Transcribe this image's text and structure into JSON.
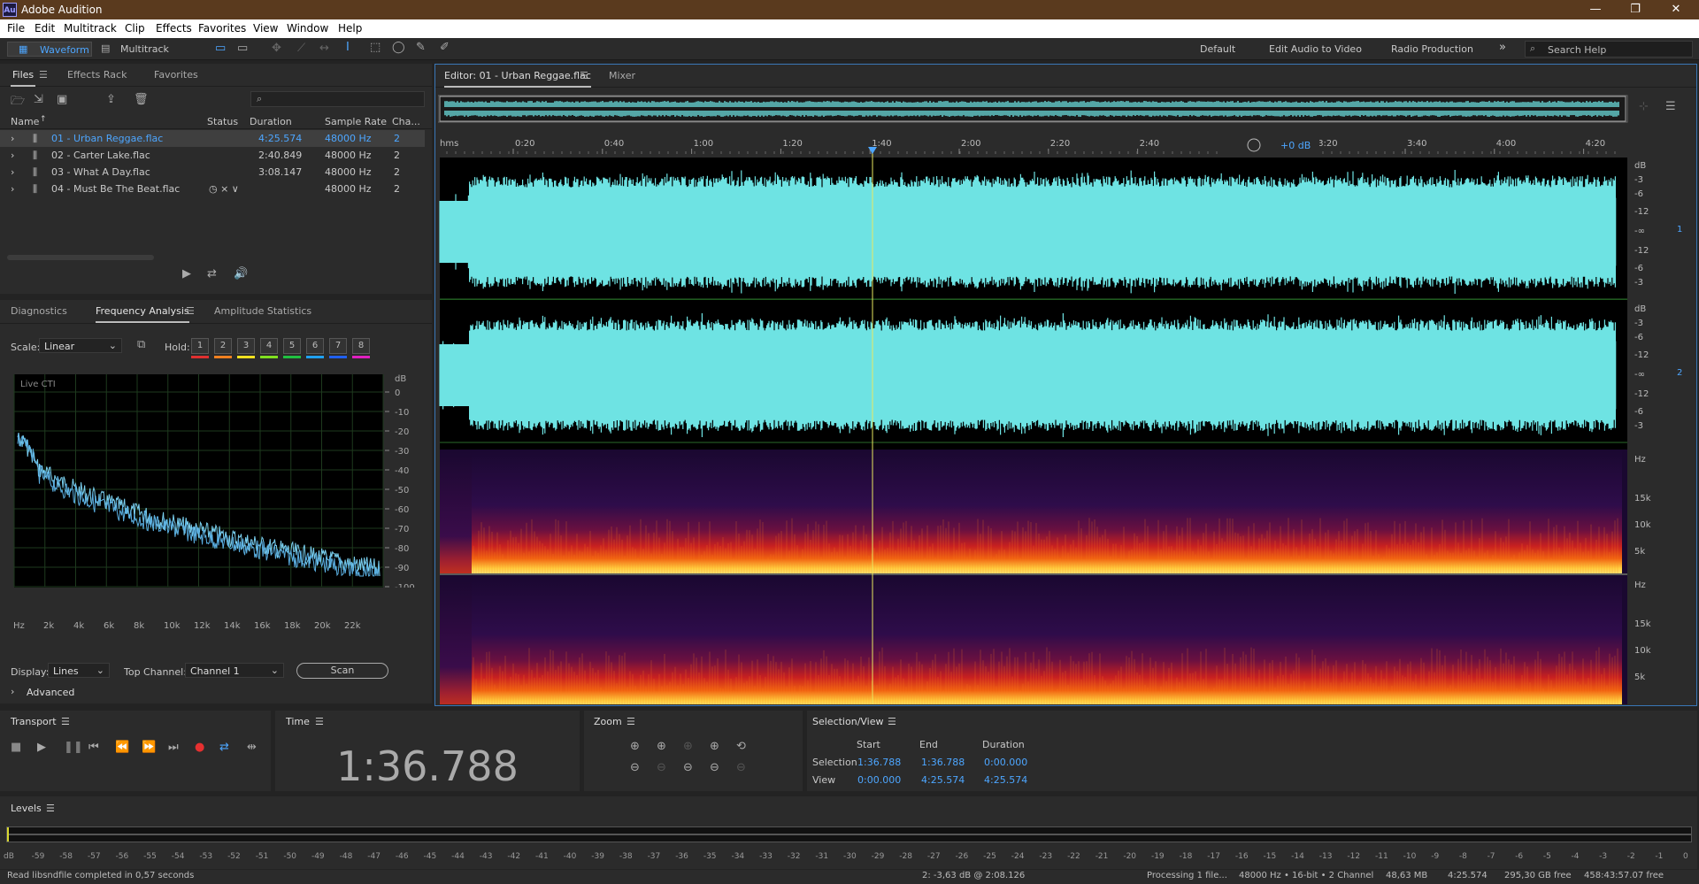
{
  "app": {
    "title": "Adobe Audition",
    "logo": "Au"
  },
  "window_buttons": [
    "—",
    "❐",
    "✕"
  ],
  "menu": [
    "File",
    "Edit",
    "Multitrack",
    "Clip",
    "Effects",
    "Favorites",
    "View",
    "Window",
    "Help"
  ],
  "toolbar": {
    "waveform": "Waveform",
    "multitrack": "Multitrack",
    "workspaces": [
      "Default",
      "Edit Audio to Video",
      "Radio Production"
    ],
    "more": "»",
    "search_placeholder": "Search Help"
  },
  "files_panel": {
    "tabs": [
      "Files",
      "Effects Rack",
      "Favorites"
    ],
    "columns": [
      "Name",
      "Status",
      "Duration",
      "Sample Rate",
      "Cha..."
    ],
    "rows": [
      {
        "name": "01 - Urban Reggae.flac",
        "duration": "4:25.574",
        "rate": "48000 Hz",
        "ch": "2"
      },
      {
        "name": "02 - Carter Lake.flac",
        "duration": "2:40.849",
        "rate": "48000 Hz",
        "ch": "2"
      },
      {
        "name": "03 - What A Day.flac",
        "duration": "3:08.147",
        "rate": "48000 Hz",
        "ch": "2"
      },
      {
        "name": "04 - Must Be The Beat.flac",
        "duration": "",
        "rate": "48000 Hz",
        "ch": "2"
      }
    ]
  },
  "freq_panel": {
    "tabs": [
      "Diagnostics",
      "Frequency Analysis",
      "Amplitude Statistics"
    ],
    "scale_label": "Scale:",
    "scale_value": "Linear",
    "hold_label": "Hold:",
    "holds": [
      "1",
      "2",
      "3",
      "4",
      "5",
      "6",
      "7",
      "8"
    ],
    "hold_colors": [
      "#e03030",
      "#f08020",
      "#f0e020",
      "#80e020",
      "#20c040",
      "#20a0f0",
      "#2060f0",
      "#e020c0"
    ],
    "graph_label": "Live CTI",
    "db_unit": "dB",
    "db_ticks": [
      "0",
      "-10",
      "-20",
      "-30",
      "-40",
      "-50",
      "-60",
      "-70",
      "-80",
      "-90",
      "-100"
    ],
    "hz_ticks": [
      "Hz",
      "2k",
      "4k",
      "6k",
      "8k",
      "10k",
      "12k",
      "14k",
      "16k",
      "18k",
      "20k",
      "22k"
    ],
    "display_label": "Display:",
    "display_value": "Lines",
    "top_channel_label": "Top Channel:",
    "top_channel_value": "Channel 1",
    "scan": "Scan",
    "advanced": "Advanced"
  },
  "editor": {
    "tab": "Editor: 01 - Urban Reggae.flac",
    "mixer": "Mixer",
    "ruler": [
      "hms",
      "0:20",
      "0:40",
      "1:00",
      "1:20",
      "1:40",
      "2:00",
      "2:20",
      "2:40",
      "3:00",
      "3:20",
      "3:40",
      "4:00",
      "4:20"
    ],
    "gain": "+0 dB",
    "db_scale": [
      "dB",
      "-3",
      "-6",
      "-12",
      "-∞",
      "-12",
      "-6",
      "-3"
    ],
    "channels": [
      "1",
      "2"
    ],
    "hz_scale": [
      "Hz",
      "15k",
      "10k",
      "5k"
    ]
  },
  "transport": {
    "title": "Transport"
  },
  "time": {
    "title": "Time",
    "value": "1:36.788"
  },
  "zoom": {
    "title": "Zoom"
  },
  "selection": {
    "title": "Selection/View",
    "headers": [
      "Start",
      "End",
      "Duration"
    ],
    "rows": [
      {
        "label": "Selection",
        "start": "1:36.788",
        "end": "1:36.788",
        "dur": "0:00.000"
      },
      {
        "label": "View",
        "start": "0:00.000",
        "end": "4:25.574",
        "dur": "4:25.574"
      }
    ]
  },
  "levels": {
    "title": "Levels",
    "ticks": [
      "dB",
      "-59",
      "-58",
      "-57",
      "-56",
      "-55",
      "-54",
      "-53",
      "-52",
      "-51",
      "-50",
      "-49",
      "-48",
      "-47",
      "-46",
      "-45",
      "-44",
      "-43",
      "-42",
      "-41",
      "-40",
      "-39",
      "-38",
      "-37",
      "-36",
      "-35",
      "-34",
      "-33",
      "-32",
      "-31",
      "-30",
      "-29",
      "-28",
      "-27",
      "-26",
      "-25",
      "-24",
      "-23",
      "-22",
      "-21",
      "-20",
      "-19",
      "-18",
      "-17",
      "-16",
      "-15",
      "-14",
      "-13",
      "-12",
      "-11",
      "-10",
      "-9",
      "-8",
      "-7",
      "-6",
      "-5",
      "-4",
      "-3",
      "-2",
      "-1",
      "0"
    ]
  },
  "status": {
    "left": "Read libsndfile completed in 0,57 seconds",
    "cursor": "2: -3,63 dB @ 2:08.126",
    "processing": "Processing 1 file...",
    "format": "48000 Hz • 16-bit • 2 Channel",
    "size": "48,63 MB",
    "duration": "4:25.574",
    "free": "295,30 GB free",
    "free_time": "458:43:57.07 free"
  },
  "colors": {
    "accent": "#4da6ff",
    "wave": "#6ee3e3",
    "playhead": "#e8e860"
  },
  "waveform_data": {
    "envelope_mean": [
      0.86,
      0.88,
      0.87,
      0.89,
      0.86,
      0.88,
      0.87,
      0.88,
      0.86,
      0.87,
      0.89,
      0.88,
      0.86,
      0.87,
      0.88,
      0.86
    ],
    "intro_level": 0.5,
    "end_fraction": 0.995
  }
}
